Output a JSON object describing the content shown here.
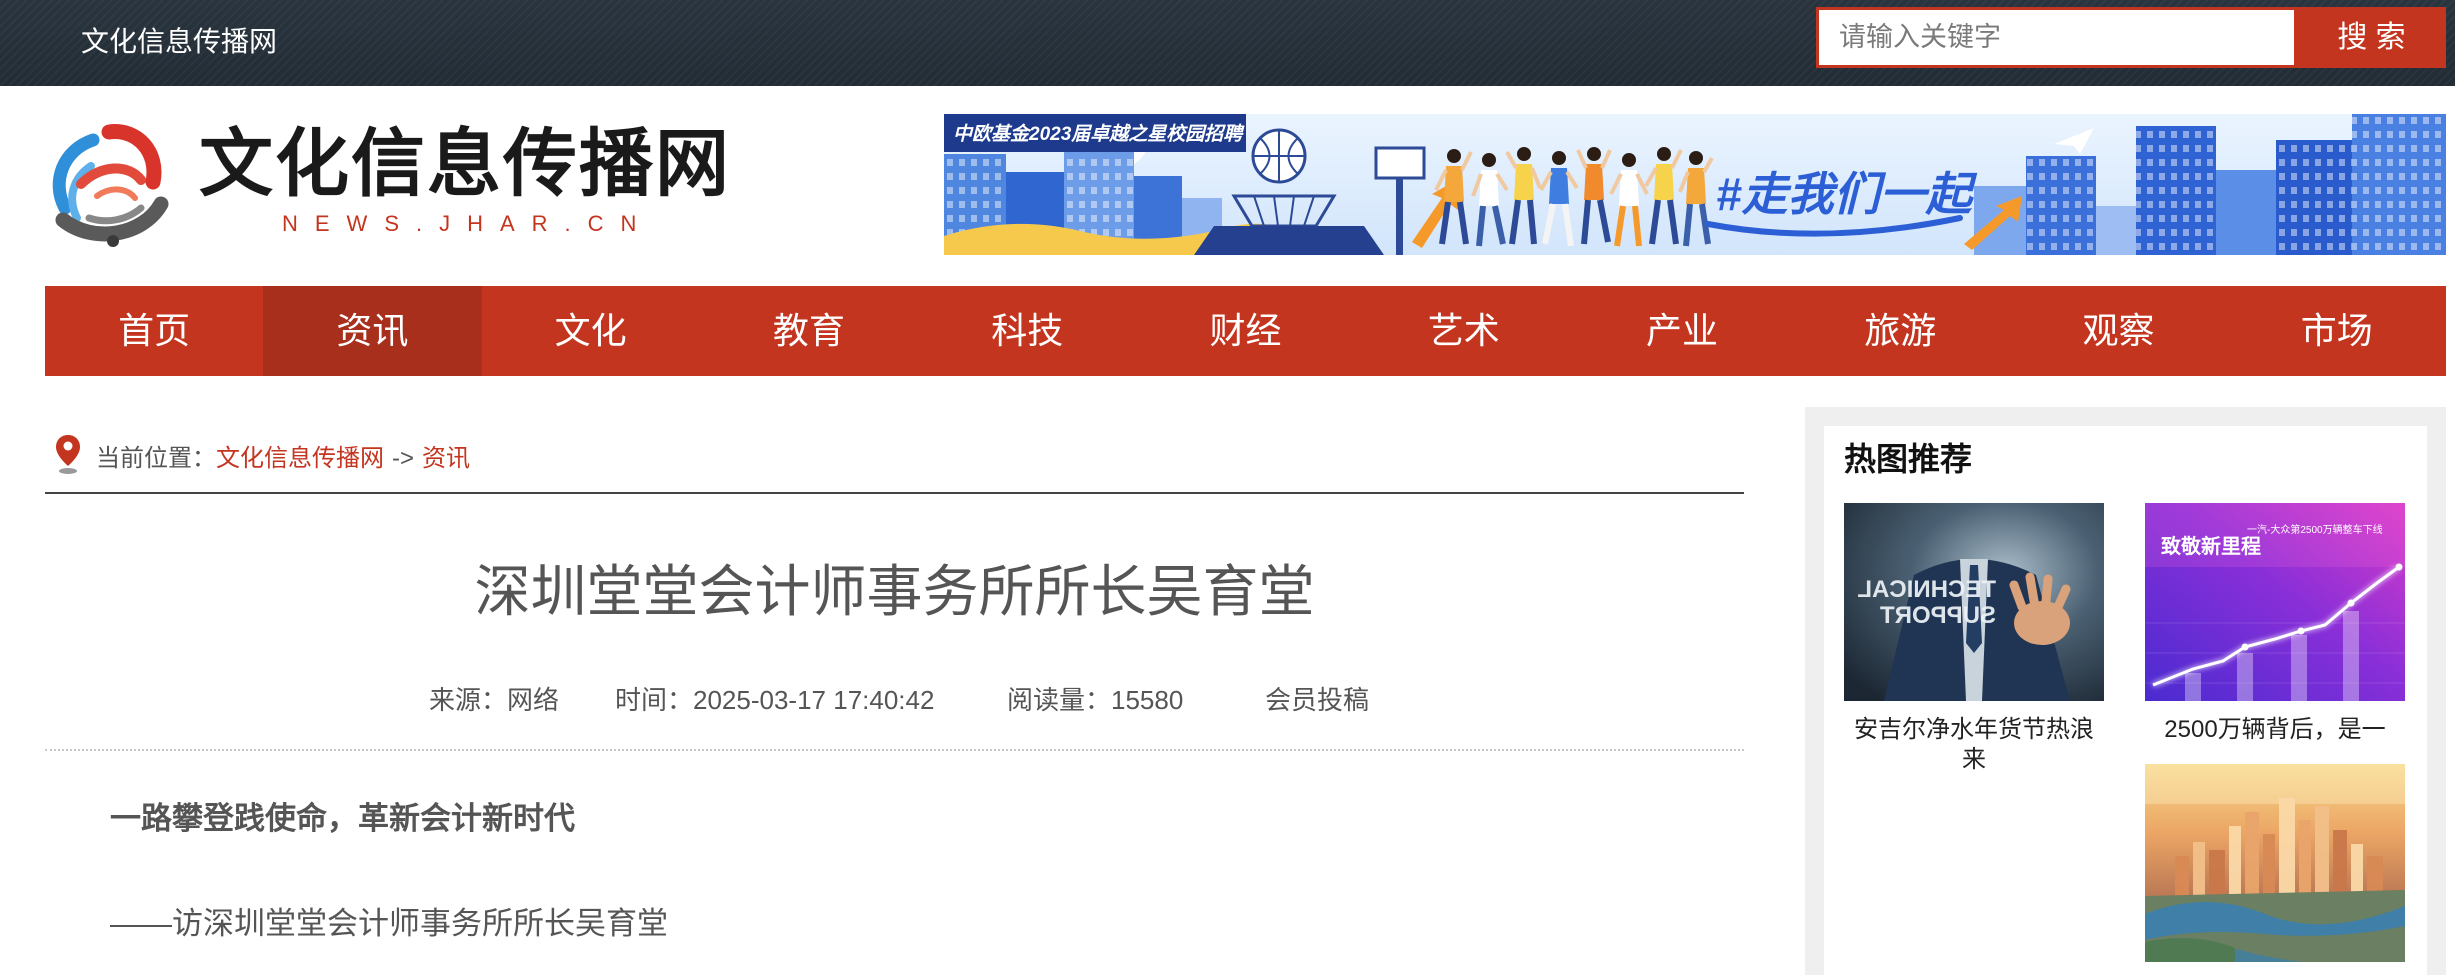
{
  "topbar": {
    "site_name": "文化信息传播网",
    "search": {
      "placeholder": "请输入关键字",
      "button_label": "搜 索"
    }
  },
  "header": {
    "logo": {
      "title": "文化信息传播网",
      "domain": "NEWS.JHAR.CN",
      "icon": "globe-swirl-logo-icon"
    },
    "banner": {
      "tag": "中欧基金2023届卓越之星校园招聘",
      "slogan": "#走我们一起"
    }
  },
  "nav": {
    "items": [
      {
        "label": "首页"
      },
      {
        "label": "资讯",
        "active": true
      },
      {
        "label": "文化"
      },
      {
        "label": "教育"
      },
      {
        "label": "科技"
      },
      {
        "label": "财经"
      },
      {
        "label": "艺术"
      },
      {
        "label": "产业"
      },
      {
        "label": "旅游"
      },
      {
        "label": "观察"
      },
      {
        "label": "市场"
      }
    ]
  },
  "breadcrumb": {
    "icon": "map-pin-icon",
    "prefix": "当前位置：",
    "home": "文化信息传播网",
    "separator": "->",
    "current": "资讯"
  },
  "article": {
    "title": "深圳堂堂会计师事务所所长吴育堂",
    "meta": {
      "source_label": "来源：",
      "source": "网络",
      "time_label": "时间：",
      "time": "2025-03-17 17:40:42",
      "views_label": "阅读量：",
      "views": "15580",
      "contributor": "会员投稿"
    },
    "paragraphs": [
      {
        "text": "一路攀登践使命，革新会计新时代",
        "bold": true
      },
      {
        "text": "——访深圳堂堂会计师事务所所长吴育堂",
        "bold": false
      }
    ]
  },
  "sidebar": {
    "heading": "热图推荐",
    "items": [
      {
        "caption": "安吉尔净水年货节热浪来",
        "image_text": [
          "TECHNICAL",
          "SUPPORT"
        ]
      },
      {
        "caption": "2500万辆背后，是一",
        "image_text": [
          "致敬新里程",
          "一汽-大众第2500万辆整车下线"
        ]
      }
    ]
  },
  "colors": {
    "brand_red": "#c4351f",
    "nav_active": "#a82f1c",
    "topbar_bg": "#222c35",
    "text": "#555555",
    "sidebar_bg": "#efefef"
  }
}
